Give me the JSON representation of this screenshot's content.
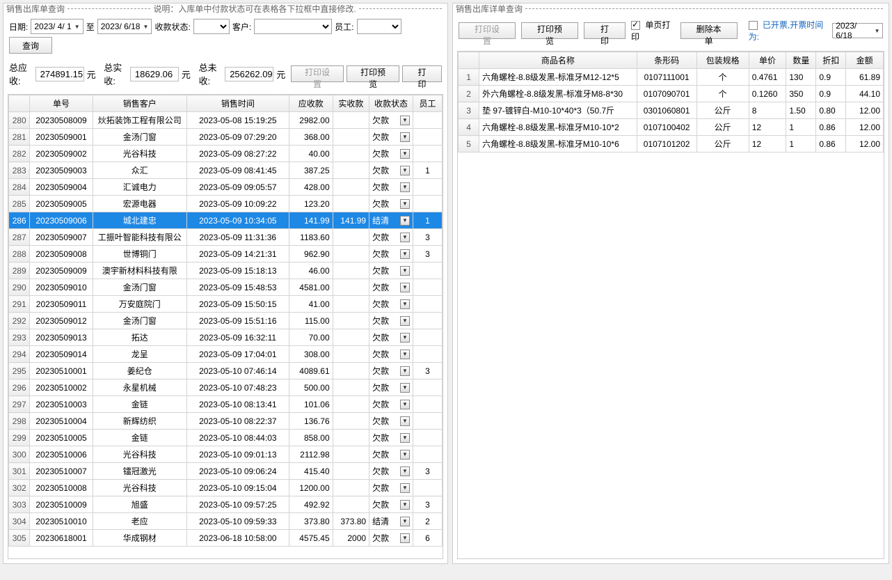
{
  "left": {
    "title": "销售出库单查询",
    "note": "说明：入库单中付款状态可在表格各下拉框中直接修改.",
    "labels": {
      "date": "日期:",
      "to": "至",
      "status": "收款状态:",
      "customer": "客户:",
      "emp": "员工:",
      "query": "查询",
      "total_due": "总应收:",
      "total_paid": "总实收:",
      "total_unpaid": "总未收:",
      "unit": "元",
      "print_setting": "打印设置",
      "print_preview": "打印预览",
      "print": "打印"
    },
    "date_from": "2023/ 4/ 1",
    "date_to": "2023/ 6/18",
    "total_due": "274891.15",
    "total_paid": "18629.06",
    "total_unpaid": "256262.09",
    "columns": [
      "单号",
      "销售客户",
      "销售时间",
      "应收款",
      "实收款",
      "收款状态",
      "员工"
    ],
    "selected_index": 6,
    "rows": [
      {
        "n": 280,
        "no": "20230508009",
        "cust": "炏拓装饰工程有限公司",
        "time": "2023-05-08 15:19:25",
        "due": "2982.00",
        "paid": "",
        "status": "欠款",
        "emp": ""
      },
      {
        "n": 281,
        "no": "20230509001",
        "cust": "金汤门窗",
        "time": "2023-05-09 07:29:20",
        "due": "368.00",
        "paid": "",
        "status": "欠款",
        "emp": ""
      },
      {
        "n": 282,
        "no": "20230509002",
        "cust": "光谷科技",
        "time": "2023-05-09 08:27:22",
        "due": "40.00",
        "paid": "",
        "status": "欠款",
        "emp": ""
      },
      {
        "n": 283,
        "no": "20230509003",
        "cust": "众汇",
        "time": "2023-05-09 08:41:45",
        "due": "387.25",
        "paid": "",
        "status": "欠款",
        "emp": "1"
      },
      {
        "n": 284,
        "no": "20230509004",
        "cust": "汇诚电力",
        "time": "2023-05-09 09:05:57",
        "due": "428.00",
        "paid": "",
        "status": "欠款",
        "emp": ""
      },
      {
        "n": 285,
        "no": "20230509005",
        "cust": "宏源电器",
        "time": "2023-05-09 10:09:22",
        "due": "123.20",
        "paid": "",
        "status": "欠款",
        "emp": ""
      },
      {
        "n": 286,
        "no": "20230509006",
        "cust": "城北建忠",
        "time": "2023-05-09 10:34:05",
        "due": "141.99",
        "paid": "141.99",
        "status": "结清",
        "emp": "1"
      },
      {
        "n": 287,
        "no": "20230509007",
        "cust": "工振叶智能科技有限公",
        "time": "2023-05-09 11:31:36",
        "due": "1183.60",
        "paid": "",
        "status": "欠款",
        "emp": "3"
      },
      {
        "n": 288,
        "no": "20230509008",
        "cust": "世博铜门",
        "time": "2023-05-09 14:21:31",
        "due": "962.90",
        "paid": "",
        "status": "欠款",
        "emp": "3"
      },
      {
        "n": 289,
        "no": "20230509009",
        "cust": "澳宇新材料科技有限",
        "time": "2023-05-09 15:18:13",
        "due": "46.00",
        "paid": "",
        "status": "欠款",
        "emp": ""
      },
      {
        "n": 290,
        "no": "20230509010",
        "cust": "金汤门窗",
        "time": "2023-05-09 15:48:53",
        "due": "4581.00",
        "paid": "",
        "status": "欠款",
        "emp": ""
      },
      {
        "n": 291,
        "no": "20230509011",
        "cust": "万安庭院门",
        "time": "2023-05-09 15:50:15",
        "due": "41.00",
        "paid": "",
        "status": "欠款",
        "emp": ""
      },
      {
        "n": 292,
        "no": "20230509012",
        "cust": "金汤门窗",
        "time": "2023-05-09 15:51:16",
        "due": "115.00",
        "paid": "",
        "status": "欠款",
        "emp": ""
      },
      {
        "n": 293,
        "no": "20230509013",
        "cust": "拓达",
        "time": "2023-05-09 16:32:11",
        "due": "70.00",
        "paid": "",
        "status": "欠款",
        "emp": ""
      },
      {
        "n": 294,
        "no": "20230509014",
        "cust": "龙呈",
        "time": "2023-05-09 17:04:01",
        "due": "308.00",
        "paid": "",
        "status": "欠款",
        "emp": ""
      },
      {
        "n": 295,
        "no": "20230510001",
        "cust": "姜纪仓",
        "time": "2023-05-10 07:46:14",
        "due": "4089.61",
        "paid": "",
        "status": "欠款",
        "emp": "3"
      },
      {
        "n": 296,
        "no": "20230510002",
        "cust": "永星机械",
        "time": "2023-05-10 07:48:23",
        "due": "500.00",
        "paid": "",
        "status": "欠款",
        "emp": ""
      },
      {
        "n": 297,
        "no": "20230510003",
        "cust": "金链",
        "time": "2023-05-10 08:13:41",
        "due": "101.06",
        "paid": "",
        "status": "欠款",
        "emp": ""
      },
      {
        "n": 298,
        "no": "20230510004",
        "cust": "新辉纺织",
        "time": "2023-05-10 08:22:37",
        "due": "136.76",
        "paid": "",
        "status": "欠款",
        "emp": ""
      },
      {
        "n": 299,
        "no": "20230510005",
        "cust": "金链",
        "time": "2023-05-10 08:44:03",
        "due": "858.00",
        "paid": "",
        "status": "欠款",
        "emp": ""
      },
      {
        "n": 300,
        "no": "20230510006",
        "cust": "光谷科技",
        "time": "2023-05-10 09:01:13",
        "due": "2112.98",
        "paid": "",
        "status": "欠款",
        "emp": ""
      },
      {
        "n": 301,
        "no": "20230510007",
        "cust": "镭冠激光",
        "time": "2023-05-10 09:06:24",
        "due": "415.40",
        "paid": "",
        "status": "欠款",
        "emp": "3"
      },
      {
        "n": 302,
        "no": "20230510008",
        "cust": "光谷科技",
        "time": "2023-05-10 09:15:04",
        "due": "1200.00",
        "paid": "",
        "status": "欠款",
        "emp": ""
      },
      {
        "n": 303,
        "no": "20230510009",
        "cust": "旭盛",
        "time": "2023-05-10 09:57:25",
        "due": "492.92",
        "paid": "",
        "status": "欠款",
        "emp": "3"
      },
      {
        "n": 304,
        "no": "20230510010",
        "cust": "老应",
        "time": "2023-05-10 09:59:33",
        "due": "373.80",
        "paid": "373.80",
        "status": "结清",
        "emp": "2"
      },
      {
        "n": 305,
        "no": "20230618001",
        "cust": "华成钢材",
        "time": "2023-06-18 10:58:00",
        "due": "4575.45",
        "paid": "2000",
        "status": "欠款",
        "emp": "6"
      }
    ]
  },
  "right": {
    "title": "销售出库详单查询",
    "labels": {
      "print_setting": "打印设置",
      "print_preview": "打印预览",
      "print": "打印",
      "single_page": "单页打印",
      "delete": "删除本单",
      "invoiced": "已开票,开票时间为:"
    },
    "invoice_date": "2023/ 6/18",
    "columns": [
      "商品名称",
      "条形码",
      "包装规格",
      "单价",
      "数量",
      "折扣",
      "金额"
    ],
    "rows": [
      {
        "n": 1,
        "name": "六角螺栓-8.8级发黑-标准牙M12-12*5",
        "code": "0107111001",
        "spec": "个",
        "price": "0.4761",
        "qty": "130",
        "disc": "0.9",
        "amt": "61.89"
      },
      {
        "n": 2,
        "name": "外六角螺栓-8.8级发黑-标准牙M8-8*30",
        "code": "0107090701",
        "spec": "个",
        "price": "0.1260",
        "qty": "350",
        "disc": "0.9",
        "amt": "44.10"
      },
      {
        "n": 3,
        "name": "垫 97-镀锌白-M10-10*40*3（50.7斤",
        "code": "0301060801",
        "spec": "公斤",
        "price": "8",
        "qty": "1.50",
        "disc": "0.80",
        "amt": "12.00"
      },
      {
        "n": 4,
        "name": "六角螺栓-8.8级发黑-标准牙M10-10*2",
        "code": "0107100402",
        "spec": "公斤",
        "price": "12",
        "qty": "1",
        "disc": "0.86",
        "amt": "12.00"
      },
      {
        "n": 5,
        "name": "六角螺栓-8.8级发黑-标准牙M10-10*6",
        "code": "0107101202",
        "spec": "公斤",
        "price": "12",
        "qty": "1",
        "disc": "0.86",
        "amt": "12.00"
      }
    ]
  }
}
